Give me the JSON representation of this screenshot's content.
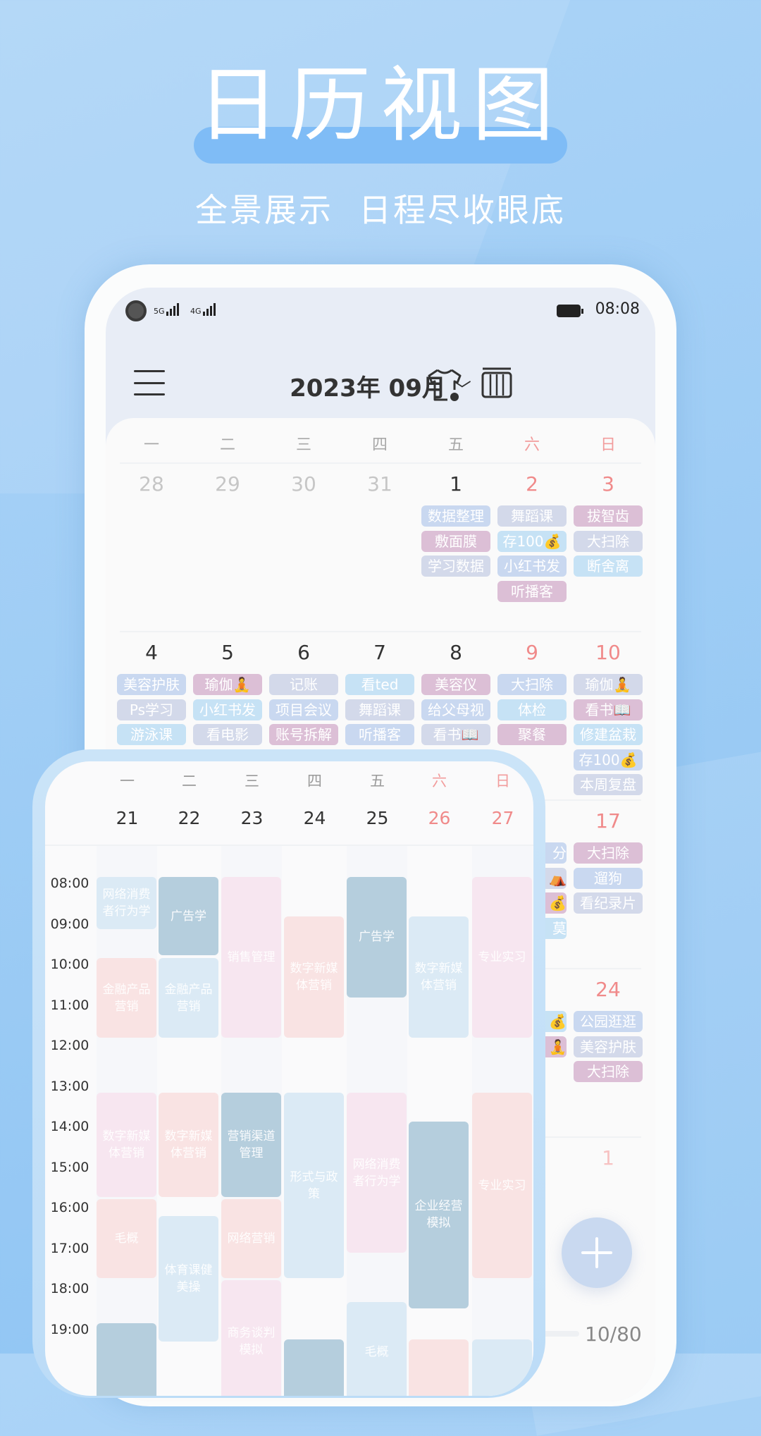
{
  "promo": {
    "title": "日历视图",
    "subtitle_1": "全景展示",
    "subtitle_2": "日程尽收眼底"
  },
  "status_bar": {
    "signal_1": "5G",
    "signal_2": "4G",
    "time": "08:08",
    "battery_icon": "battery-full-icon"
  },
  "header": {
    "menu_icon": "hamburger-menu-icon",
    "month_label": "2023年 09月",
    "dropdown_icon": "chevron-down-icon",
    "theme_icon": "tshirt-icon",
    "view_icon": "calendar-columns-icon"
  },
  "colors": {
    "lavender": "#d3d9ea",
    "blue_lavender": "#c9d8f0",
    "light_blue": "#c6e2f5",
    "pink": "#dcbfd6",
    "weekend": "#f08a8a",
    "block_dark": "#b5cedd",
    "block_blue": "#dbeaf5",
    "block_pink": "#f9e3e3",
    "block_rose": "#f7e6f0"
  },
  "month_view": {
    "weekdays": [
      "一",
      "二",
      "三",
      "四",
      "五",
      "六",
      "日"
    ],
    "weeks": [
      {
        "days": [
          {
            "d": "28",
            "kind": "prev",
            "events": []
          },
          {
            "d": "29",
            "kind": "prev",
            "events": []
          },
          {
            "d": "30",
            "kind": "prev",
            "events": []
          },
          {
            "d": "31",
            "kind": "prev",
            "events": []
          },
          {
            "d": "1",
            "kind": "normal",
            "events": [
              [
                "数据整理",
                "blue_lavender"
              ],
              [
                "敷面膜",
                "pink"
              ],
              [
                "学习数据",
                "lavender"
              ]
            ]
          },
          {
            "d": "2",
            "kind": "we",
            "events": [
              [
                "舞蹈课",
                "lavender"
              ],
              [
                "存100💰",
                "light_blue"
              ],
              [
                "小红书发",
                "blue_lavender"
              ],
              [
                "听播客",
                "pink"
              ]
            ]
          },
          {
            "d": "3",
            "kind": "we",
            "events": [
              [
                "拔智齿",
                "pink"
              ],
              [
                "大扫除",
                "lavender"
              ],
              [
                "断舍离",
                "light_blue"
              ]
            ]
          }
        ]
      },
      {
        "days": [
          {
            "d": "4",
            "kind": "normal",
            "events": [
              [
                "美容护肤",
                "blue_lavender"
              ],
              [
                "Ps学习",
                "lavender"
              ],
              [
                "游泳课",
                "light_blue"
              ]
            ]
          },
          {
            "d": "5",
            "kind": "normal",
            "events": [
              [
                "瑜伽🧘",
                "pink"
              ],
              [
                "小红书发",
                "light_blue"
              ],
              [
                "看电影",
                "lavender"
              ]
            ]
          },
          {
            "d": "6",
            "kind": "normal",
            "events": [
              [
                "记账",
                "lavender"
              ],
              [
                "项目会议",
                "blue_lavender"
              ],
              [
                "账号拆解",
                "pink"
              ]
            ]
          },
          {
            "d": "7",
            "kind": "normal",
            "events": [
              [
                "看ted",
                "light_blue"
              ],
              [
                "舞蹈课",
                "lavender"
              ],
              [
                "听播客",
                "blue_lavender"
              ]
            ]
          },
          {
            "d": "8",
            "kind": "normal",
            "events": [
              [
                "美容仪",
                "pink"
              ],
              [
                "给父母视",
                "blue_lavender"
              ],
              [
                "看书📖",
                "lavender"
              ]
            ]
          },
          {
            "d": "9",
            "kind": "we",
            "events": [
              [
                "大扫除",
                "blue_lavender"
              ],
              [
                "体检",
                "light_blue"
              ],
              [
                "聚餐",
                "pink"
              ]
            ]
          },
          {
            "d": "10",
            "kind": "we",
            "events": [
              [
                "瑜伽🧘",
                "lavender"
              ],
              [
                "看书📖",
                "pink"
              ],
              [
                "修建盆栽",
                "light_blue"
              ],
              [
                "存100💰",
                "blue_lavender"
              ],
              [
                "本周复盘",
                "lavender"
              ]
            ]
          }
        ]
      },
      {
        "days": [
          {
            "d": "",
            "kind": "hidden",
            "events": []
          },
          {
            "d": "",
            "kind": "hidden",
            "events": []
          },
          {
            "d": "",
            "kind": "hidden",
            "events": []
          },
          {
            "d": "",
            "kind": "hidden",
            "events": []
          },
          {
            "d": "",
            "kind": "hidden",
            "events": []
          },
          {
            "d": "",
            "kind": "hidden",
            "events": [
              [
                "分",
                "blue_lavender"
              ],
              [
                "⛺",
                "lavender"
              ],
              [
                "💰",
                "pink"
              ],
              [
                "莫",
                "light_blue"
              ]
            ]
          },
          {
            "d": "17",
            "kind": "we",
            "events": [
              [
                "大扫除",
                "pink"
              ],
              [
                "遛狗",
                "blue_lavender"
              ],
              [
                "看纪录片",
                "lavender"
              ]
            ]
          }
        ]
      },
      {
        "days": [
          {
            "d": "",
            "kind": "hidden",
            "events": []
          },
          {
            "d": "",
            "kind": "hidden",
            "events": []
          },
          {
            "d": "",
            "kind": "hidden",
            "events": []
          },
          {
            "d": "",
            "kind": "hidden",
            "events": []
          },
          {
            "d": "",
            "kind": "hidden",
            "events": []
          },
          {
            "d": "",
            "kind": "hidden",
            "events": [
              [
                "💰",
                "light_blue"
              ],
              [
                "🧘",
                "pink"
              ]
            ]
          },
          {
            "d": "24",
            "kind": "we",
            "events": [
              [
                "公园逛逛",
                "blue_lavender"
              ],
              [
                "美容护肤",
                "lavender"
              ],
              [
                "大扫除",
                "pink"
              ]
            ]
          }
        ]
      },
      {
        "days": [
          {
            "d": "",
            "kind": "hidden",
            "events": []
          },
          {
            "d": "",
            "kind": "hidden",
            "events": []
          },
          {
            "d": "",
            "kind": "hidden",
            "events": []
          },
          {
            "d": "",
            "kind": "hidden",
            "events": []
          },
          {
            "d": "",
            "kind": "hidden",
            "events": []
          },
          {
            "d": "",
            "kind": "hidden",
            "events": []
          },
          {
            "d": "1",
            "kind": "next",
            "events": []
          }
        ]
      }
    ],
    "fab_icon": "plus-icon",
    "progress": {
      "label": "10/80",
      "value": 10,
      "max": 80
    }
  },
  "week_view": {
    "weekdays": [
      "一",
      "二",
      "三",
      "四",
      "五",
      "六",
      "日"
    ],
    "dates": [
      "21",
      "22",
      "23",
      "24",
      "25",
      "26",
      "27"
    ],
    "weekend_index": [
      5,
      6
    ],
    "hours": [
      "08:00",
      "09:00",
      "10:00",
      "11:00",
      "12:00",
      "13:00",
      "14:00",
      "15:00",
      "16:00",
      "17:00",
      "18:00",
      "19:00"
    ],
    "events": [
      {
        "day": 0,
        "title": "网络消费者行为学",
        "start": 8.0,
        "end": 9.33,
        "color": "block_blue"
      },
      {
        "day": 0,
        "title": "金融产品营销",
        "start": 10.0,
        "end": 12.0,
        "color": "block_pink"
      },
      {
        "day": 0,
        "title": "数字新媒体营销",
        "start": 13.33,
        "end": 15.93,
        "color": "block_rose"
      },
      {
        "day": 0,
        "title": "毛概",
        "start": 15.95,
        "end": 17.93,
        "color": "block_pink"
      },
      {
        "day": 0,
        "title": "",
        "start": 19.0,
        "end": 21.0,
        "color": "block_dark"
      },
      {
        "day": 1,
        "title": "广告学",
        "start": 8.0,
        "end": 9.97,
        "color": "block_dark"
      },
      {
        "day": 1,
        "title": "金融产品营销",
        "start": 10.0,
        "end": 12.0,
        "color": "block_blue"
      },
      {
        "day": 1,
        "title": "数字新媒体营销",
        "start": 13.33,
        "end": 15.93,
        "color": "block_pink"
      },
      {
        "day": 1,
        "title": "体育课健美操",
        "start": 16.37,
        "end": 19.5,
        "color": "block_blue"
      },
      {
        "day": 2,
        "title": "销售管理",
        "start": 8.0,
        "end": 12.0,
        "color": "block_rose"
      },
      {
        "day": 2,
        "title": "营销渠道管理",
        "start": 13.33,
        "end": 15.93,
        "color": "block_dark"
      },
      {
        "day": 2,
        "title": "网络营销",
        "start": 15.95,
        "end": 17.93,
        "color": "block_pink"
      },
      {
        "day": 2,
        "title": "商务谈判模拟",
        "start": 17.95,
        "end": 21.0,
        "color": "block_rose"
      },
      {
        "day": 3,
        "title": "数字新媒体营销",
        "start": 8.97,
        "end": 12.0,
        "color": "block_pink"
      },
      {
        "day": 3,
        "title": "形式与政策",
        "start": 13.33,
        "end": 17.93,
        "color": "block_blue"
      },
      {
        "day": 3,
        "title": "",
        "start": 19.4,
        "end": 21.0,
        "color": "block_dark"
      },
      {
        "day": 4,
        "title": "广告学",
        "start": 8.0,
        "end": 11.0,
        "color": "block_dark"
      },
      {
        "day": 4,
        "title": "网络消费者行为学",
        "start": 13.33,
        "end": 17.3,
        "color": "block_rose"
      },
      {
        "day": 4,
        "title": "毛概",
        "start": 18.48,
        "end": 21.0,
        "color": "block_blue"
      },
      {
        "day": 5,
        "title": "数字新媒体营销",
        "start": 8.97,
        "end": 12.0,
        "color": "block_blue"
      },
      {
        "day": 5,
        "title": "企业经营模拟",
        "start": 14.03,
        "end": 18.68,
        "color": "block_dark"
      },
      {
        "day": 5,
        "title": "",
        "start": 19.4,
        "end": 21.0,
        "color": "block_pink"
      },
      {
        "day": 6,
        "title": "专业实习",
        "start": 8.0,
        "end": 12.0,
        "color": "block_rose"
      },
      {
        "day": 6,
        "title": "专业实习",
        "start": 13.33,
        "end": 17.93,
        "color": "block_pink"
      },
      {
        "day": 6,
        "title": "",
        "start": 19.4,
        "end": 21.0,
        "color": "block_blue"
      }
    ]
  }
}
